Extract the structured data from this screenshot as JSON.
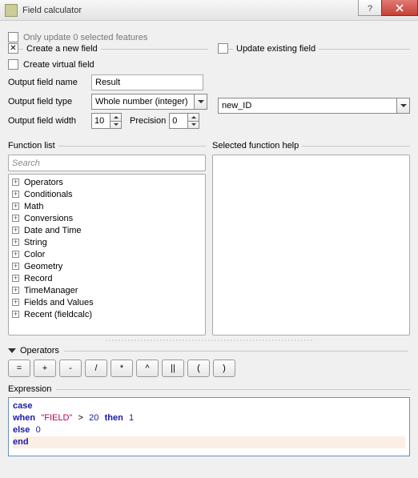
{
  "title": "Field calculator",
  "onlyUpdateLabel": "Only update 0 selected features",
  "createNew": {
    "legend": "Create a new field",
    "virtualLabel": "Create virtual field",
    "nameLabel": "Output field name",
    "nameValue": "Result",
    "typeLabel": "Output field type",
    "typeValue": "Whole number (integer)",
    "widthLabel": "Output field width",
    "widthValue": "10",
    "precisionLabel": "Precision",
    "precisionValue": "0"
  },
  "updateExisting": {
    "legend": "Update existing field",
    "field": "new_ID"
  },
  "functions": {
    "listLegend": "Function list",
    "helpLegend": "Selected function help",
    "searchPlaceholder": "Search",
    "items": [
      "Operators",
      "Conditionals",
      "Math",
      "Conversions",
      "Date and Time",
      "String",
      "Color",
      "Geometry",
      "Record",
      "TimeManager",
      "Fields and Values",
      "Recent (fieldcalc)"
    ]
  },
  "operators": {
    "legend": "Operators",
    "buttons": [
      "=",
      "+",
      "-",
      "/",
      "*",
      "^",
      "||",
      "(",
      ")"
    ]
  },
  "expression": {
    "legend": "Expression",
    "kw_case": "case",
    "kw_when": "when",
    "kw_then": "then",
    "kw_else": "else",
    "kw_end": "end",
    "field": "\"FIELD\"",
    "op": ">",
    "cmpval": "20",
    "thenval": "1",
    "elseval": "0"
  }
}
